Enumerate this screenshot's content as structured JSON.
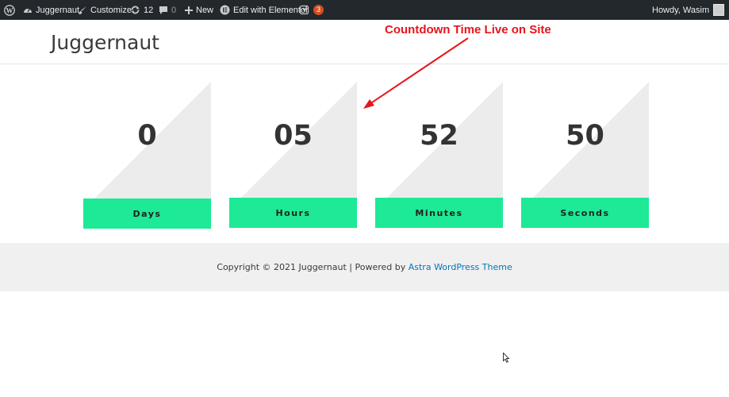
{
  "admin_bar": {
    "site_name": "Juggernaut",
    "customize": "Customize",
    "updates_count": "12",
    "comments_count": "0",
    "new_label": "New",
    "elementor_label": "Edit with Elementor",
    "yoast_badge": "3",
    "howdy": "Howdy, Wasim"
  },
  "header": {
    "site_title": "Juggernaut"
  },
  "annotation": {
    "text": "Countdown Time Live on Site",
    "color": "#e8141b"
  },
  "countdown": {
    "days": {
      "value": "0",
      "label": "Days"
    },
    "hours": {
      "value": "05",
      "label": "Hours"
    },
    "minutes": {
      "value": "52",
      "label": "Minutes"
    },
    "seconds": {
      "value": "50",
      "label": "Seconds"
    },
    "accent_color": "#1de996"
  },
  "footer": {
    "copyright": "Copyright © 2021 Juggernaut | Powered by ",
    "theme_link": "Astra WordPress Theme"
  }
}
